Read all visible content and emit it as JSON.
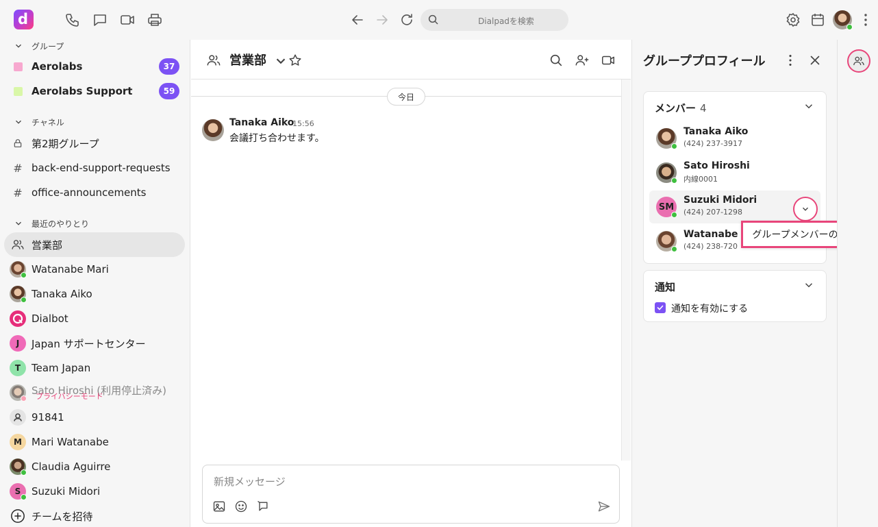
{
  "app": {
    "logo_letter": "d"
  },
  "topbar": {
    "search_placeholder": "Dialpadを検索",
    "icons": [
      "phone-icon",
      "chat-icon",
      "video-icon",
      "printer-icon",
      "back-arrow-icon",
      "forward-arrow-icon",
      "refresh-icon",
      "settings-icon",
      "calendar-icon",
      "more-icon"
    ]
  },
  "sidebar": {
    "groups_header": "グループ",
    "groups": [
      {
        "label": "Aerolabs",
        "badge": "37",
        "color": "#f7a8cf"
      },
      {
        "label": "Aerolabs Support",
        "badge": "59",
        "color": "#d9f7a8"
      }
    ],
    "channels_header": "チャネル",
    "channels": [
      {
        "label": "第2期グループ",
        "icon": "lock-icon"
      },
      {
        "label": "back-end-support-requests",
        "icon": "hash-icon"
      },
      {
        "label": "office-announcements",
        "icon": "hash-icon"
      }
    ],
    "recent_header": "最近のやりとり",
    "recent": [
      {
        "label": "営業部",
        "icon": "group-icon",
        "active": true
      },
      {
        "label": "Watanabe Mari"
      },
      {
        "label": "Tanaka Aiko"
      },
      {
        "label": "Dialbot"
      },
      {
        "label": "Japan サポートセンター",
        "initial": "J"
      },
      {
        "label": "Team Japan",
        "initial": "T"
      },
      {
        "label": "Sato Hiroshi (利用停止済み)",
        "sub": "プライバシーモード"
      },
      {
        "label": "91841"
      },
      {
        "label": "Mari Watanabe",
        "initial": "M"
      },
      {
        "label": "Claudia Aguirre"
      },
      {
        "label": "Suzuki Midori",
        "initial": "S"
      }
    ],
    "invite_label": "チームを招待"
  },
  "chat": {
    "title": "営業部",
    "date_label": "今日",
    "messages": [
      {
        "author": "Tanaka Aiko",
        "time": "15:56",
        "text": "会議打ち合わせます。"
      }
    ],
    "composer_placeholder": "新規メッセージ"
  },
  "panel": {
    "title": "グループプロフィール",
    "members_label": "メンバー",
    "members_count": "4",
    "members": [
      {
        "name": "Tanaka Aiko",
        "sub": "(424) 237-3917"
      },
      {
        "name": "Sato Hiroshi",
        "sub": "内線0001"
      },
      {
        "name": "Suzuki Midori",
        "sub": "(424) 207-1298",
        "initials": "SM"
      },
      {
        "name": "Watanabe M",
        "sub": "(424) 238-720"
      }
    ],
    "tooltip": "グループメンバーの削除",
    "notifications_label": "通知",
    "notifications_checkbox": "通知を有効にする",
    "notifications_enabled": true
  },
  "colors": {
    "accent": "#7c52f4",
    "highlight": "#e8457a",
    "online": "#3fbf3f"
  }
}
